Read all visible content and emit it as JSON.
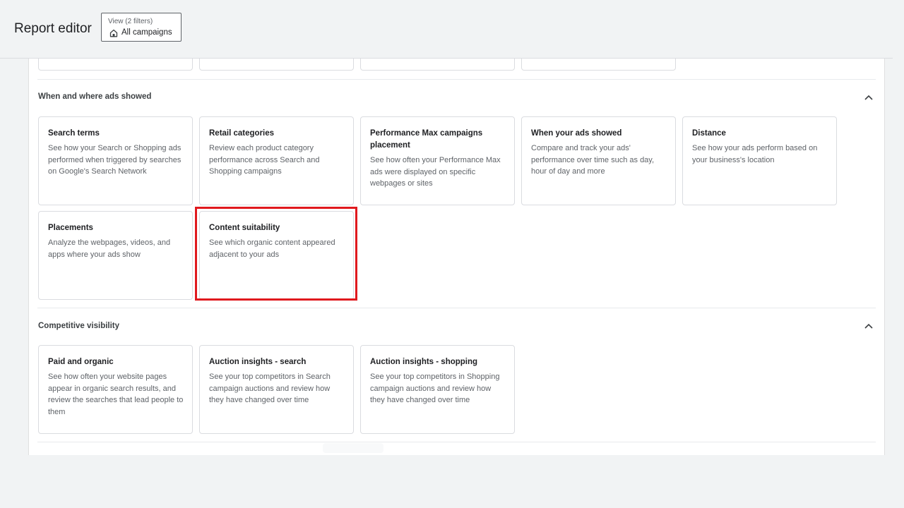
{
  "header": {
    "title": "Report editor",
    "view_chip": {
      "label": "View (2 filters)",
      "value": "All campaigns",
      "icon": "home-icon"
    }
  },
  "sections": [
    {
      "title": "When and where ads showed",
      "expanded": true,
      "cards": [
        {
          "title": "Search terms",
          "desc": "See how your Search or Shopping ads performed when triggered by searches on Google's Search Network"
        },
        {
          "title": "Retail categories",
          "desc": "Review each product category performance across Search and Shopping campaigns"
        },
        {
          "title": "Performance Max campaigns placement",
          "desc": "See how often your Performance Max ads were displayed on specific webpages or sites"
        },
        {
          "title": "When your ads showed",
          "desc": "Compare and track your ads' performance over time such as day, hour of day and more"
        },
        {
          "title": "Distance",
          "desc": "See how your ads perform based on your business's location"
        },
        {
          "title": "Placements",
          "desc": "Analyze the webpages, videos, and apps where your ads show"
        },
        {
          "title": "Content suitability",
          "desc": "See which organic content appeared adjacent to your ads",
          "highlighted": true
        }
      ]
    },
    {
      "title": "Competitive visibility",
      "expanded": true,
      "cards": [
        {
          "title": "Paid and organic",
          "desc": "See how often your website pages appear in organic search results, and review the searches that lead people to them"
        },
        {
          "title": "Auction insights - search",
          "desc": "See your top competitors in Search campaign auctions and review how they have changed over time"
        },
        {
          "title": "Auction insights - shopping",
          "desc": "See your top competitors in Shopping campaign auctions and review how they have changed over time"
        }
      ]
    }
  ],
  "colors": {
    "highlight": "#e0191e",
    "card_border": "#dadce0",
    "background": "#f1f3f4"
  }
}
